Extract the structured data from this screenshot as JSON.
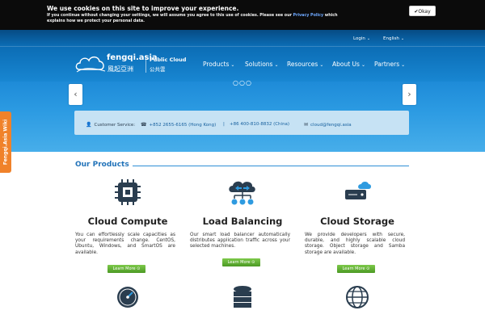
{
  "cookie": {
    "title": "We use cookies on this site to improve your experience.",
    "text_before": "If you continue without changing your settings, we will assume you agree to this use of cookies. Please see our ",
    "link": "Privacy Policy",
    "text_after": " which explains how we protect your personal data.",
    "okay_label": "Okay"
  },
  "toplinks": {
    "login": "Login",
    "language": "English"
  },
  "logo": {
    "name": "fengqi.asia",
    "name_cn": "風起亞洲",
    "product": "Public Cloud",
    "product_cn": "公共雲"
  },
  "nav": [
    {
      "label": "Products"
    },
    {
      "label": "Solutions"
    },
    {
      "label": "Resources"
    },
    {
      "label": "About Us"
    },
    {
      "label": "Partners"
    }
  ],
  "slider": {
    "dots": "○○○"
  },
  "customer_service": {
    "label": "Customer Service:",
    "phone_hk": "+852 2655-6165 (Hong Kong)",
    "separator": "|",
    "phone_cn": "+86 400-810-8832 (China)",
    "email": "cloud@fengqi.asia"
  },
  "wiki_tab": "Fengqi.Asia Wiki",
  "products_section": {
    "title": "Our Products",
    "items": [
      {
        "name": "Cloud Compute",
        "desc": "You can effortlessly scale capacities as your requirements change. CentOS, Ubuntu, Windows, and SmartOS are available.",
        "cta": "Learn More"
      },
      {
        "name": "Load Balancing",
        "desc": "Our smart load balancer automatically distributes application traffic across your selected machines.",
        "cta": "Learn More"
      },
      {
        "name": "Cloud Storage",
        "desc": "We provide developers with secure, durable, and highly scalable cloud storage. Object storage and Samba storage are available.",
        "cta": "Learn More"
      }
    ]
  },
  "colors": {
    "accent": "#2273b9",
    "header": "#0b6cb4",
    "cta": "#5aa92f",
    "wiki": "#f0822a"
  }
}
